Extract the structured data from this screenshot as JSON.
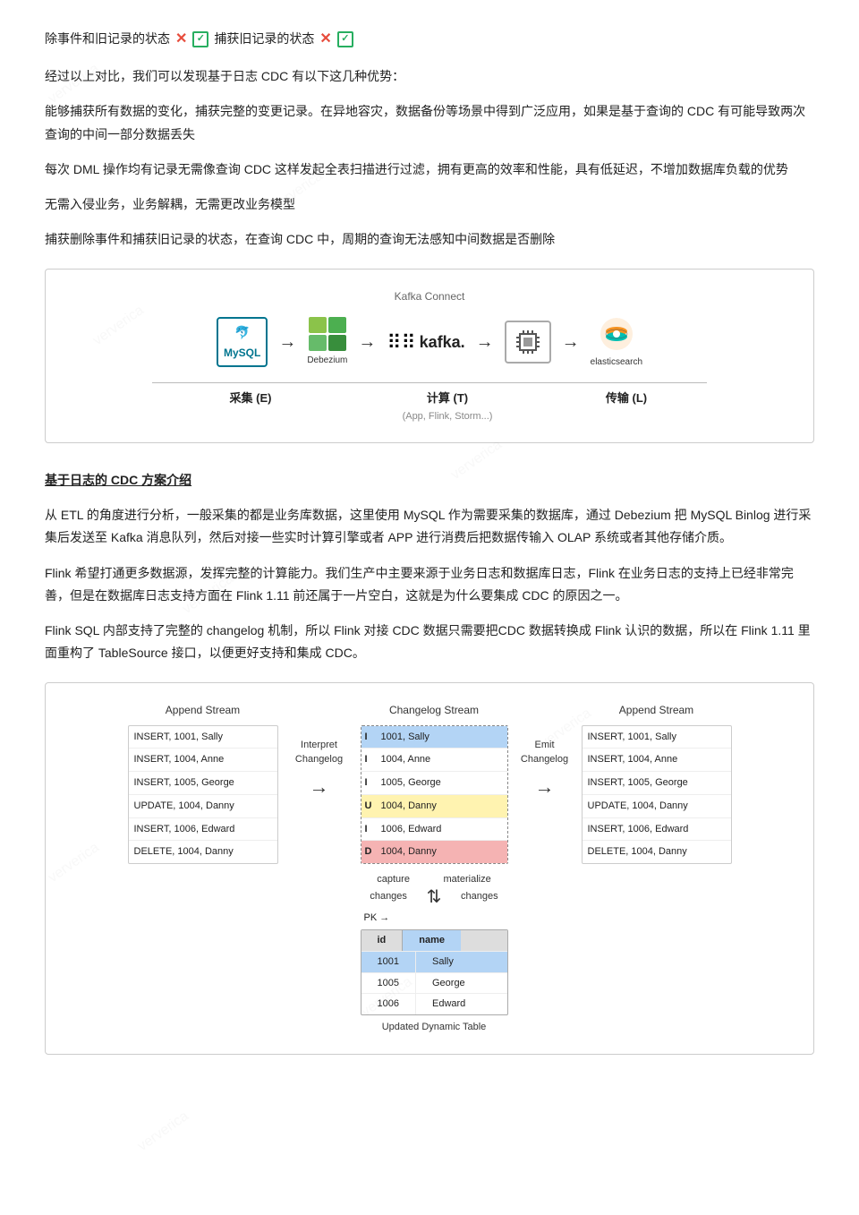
{
  "header": {
    "line1_text": "除事件和旧记录的状态",
    "line2_text": "捕获旧记录的状态",
    "cross_symbol": "✕",
    "check_symbol": "✓"
  },
  "paragraphs": [
    {
      "id": "p1",
      "text": "经过以上对比，我们可以发现基于日志 CDC 有以下这几种优势："
    },
    {
      "id": "p2",
      "text": "能够捕获所有数据的变化，捕获完整的变更记录。在异地容灾，数据备份等场景中得到广泛应用，如果是基于查询的 CDC 有可能导致两次查询的中间一部分数据丢失"
    },
    {
      "id": "p3",
      "text": "每次 DML 操作均有记录无需像查询 CDC 这样发起全表扫描进行过滤，拥有更高的效率和性能，具有低延迟，不增加数据库负载的优势"
    },
    {
      "id": "p4",
      "text": "无需入侵业务，业务解耦，无需更改业务模型"
    },
    {
      "id": "p5",
      "text": "捕获删除事件和捕获旧记录的状态，在查询 CDC 中，周期的查询无法感知中间数据是否删除"
    }
  ],
  "arch_diagram": {
    "title": "Kafka Connect",
    "components": [
      {
        "id": "mysql",
        "label": "MySQL"
      },
      {
        "id": "debezium",
        "label": "Debezium"
      },
      {
        "id": "kafka",
        "label": "kafka"
      },
      {
        "id": "flink",
        "label": ""
      },
      {
        "id": "elasticsearch",
        "label": "elasticsearch"
      }
    ],
    "stages": [
      {
        "label": "采集 (E)",
        "sub": ""
      },
      {
        "label": "计算 (T)",
        "sub": "(App, Flink, Storm...)"
      },
      {
        "label": "传输 (L)",
        "sub": ""
      }
    ]
  },
  "section_title": "基于日志的 CDC 方案介绍",
  "body_paragraphs": [
    {
      "id": "bp1",
      "text": "从 ETL 的角度进行分析，一般采集的都是业务库数据，这里使用 MySQL 作为需要采集的数据库，通过 Debezium 把 MySQL Binlog 进行采集后发送至 Kafka 消息队列，然后对接一些实时计算引擎或者 APP 进行消费后把数据传输入 OLAP 系统或者其他存储介质。"
    },
    {
      "id": "bp2",
      "text": "Flink 希望打通更多数据源，发挥完整的计算能力。我们生产中主要来源于业务日志和数据库日志，Flink 在业务日志的支持上已经非常完善，但是在数据库日志支持方面在 Flink 1.11 前还属于一片空白，这就是为什么要集成 CDC 的原因之一。"
    },
    {
      "id": "bp3",
      "text": "Flink SQL 内部支持了完整的 changelog 机制，所以 Flink 对接 CDC 数据只需要把CDC 数据转换成 Flink 认识的数据，所以在 Flink 1.11 里面重构了 TableSource 接口，以便更好支持和集成 CDC。"
    }
  ],
  "cdc_flow": {
    "append_stream_left": {
      "title": "Append Stream",
      "rows": [
        {
          "text": "INSERT, 1001, Sally",
          "style": ""
        },
        {
          "text": "INSERT, 1004, Anne",
          "style": ""
        },
        {
          "text": "INSERT, 1005, George",
          "style": ""
        },
        {
          "text": "UPDATE, 1004, Danny",
          "style": ""
        },
        {
          "text": "INSERT, 1006, Edward",
          "style": ""
        },
        {
          "text": "DELETE, 1004, Danny",
          "style": ""
        }
      ]
    },
    "interpret_label": "Interpret\nChangelog",
    "changelog_stream": {
      "title": "Changelog Stream",
      "rows": [
        {
          "op": "I",
          "text": "1001, Sally",
          "style": "hl-blue"
        },
        {
          "op": "I",
          "text": "1004, Anne",
          "style": ""
        },
        {
          "op": "I",
          "text": "1005, George",
          "style": ""
        },
        {
          "op": "U",
          "text": "1004, Danny",
          "style": "hl-yellow"
        },
        {
          "op": "I",
          "text": "1006, Edward",
          "style": ""
        },
        {
          "op": "D",
          "text": "1004, Danny",
          "style": "hl-red"
        }
      ]
    },
    "emit_label": "Emit\nChangelog",
    "append_stream_right": {
      "title": "Append Stream",
      "rows": [
        {
          "text": "INSERT, 1001, Sally",
          "style": ""
        },
        {
          "text": "INSERT, 1004, Anne",
          "style": ""
        },
        {
          "text": "INSERT, 1005, George",
          "style": ""
        },
        {
          "text": "UPDATE, 1004, Danny",
          "style": ""
        },
        {
          "text": "INSERT, 1006, Edward",
          "style": ""
        },
        {
          "text": "DELETE, 1004, Danny",
          "style": ""
        }
      ]
    },
    "dynamic_table": {
      "capture_label": "capture",
      "changes_label": "changes",
      "materialize_label": "materialize",
      "changes_label2": "changes",
      "pk_label": "PK →",
      "headers": [
        "id",
        "name"
      ],
      "rows": [
        {
          "id": "1001",
          "name": "Sally",
          "style": "hl-blue"
        },
        {
          "id": "1005",
          "name": "George",
          "style": ""
        },
        {
          "id": "1006",
          "name": "Edward",
          "style": ""
        }
      ],
      "updated_label": "Updated Dynamic Table"
    }
  }
}
